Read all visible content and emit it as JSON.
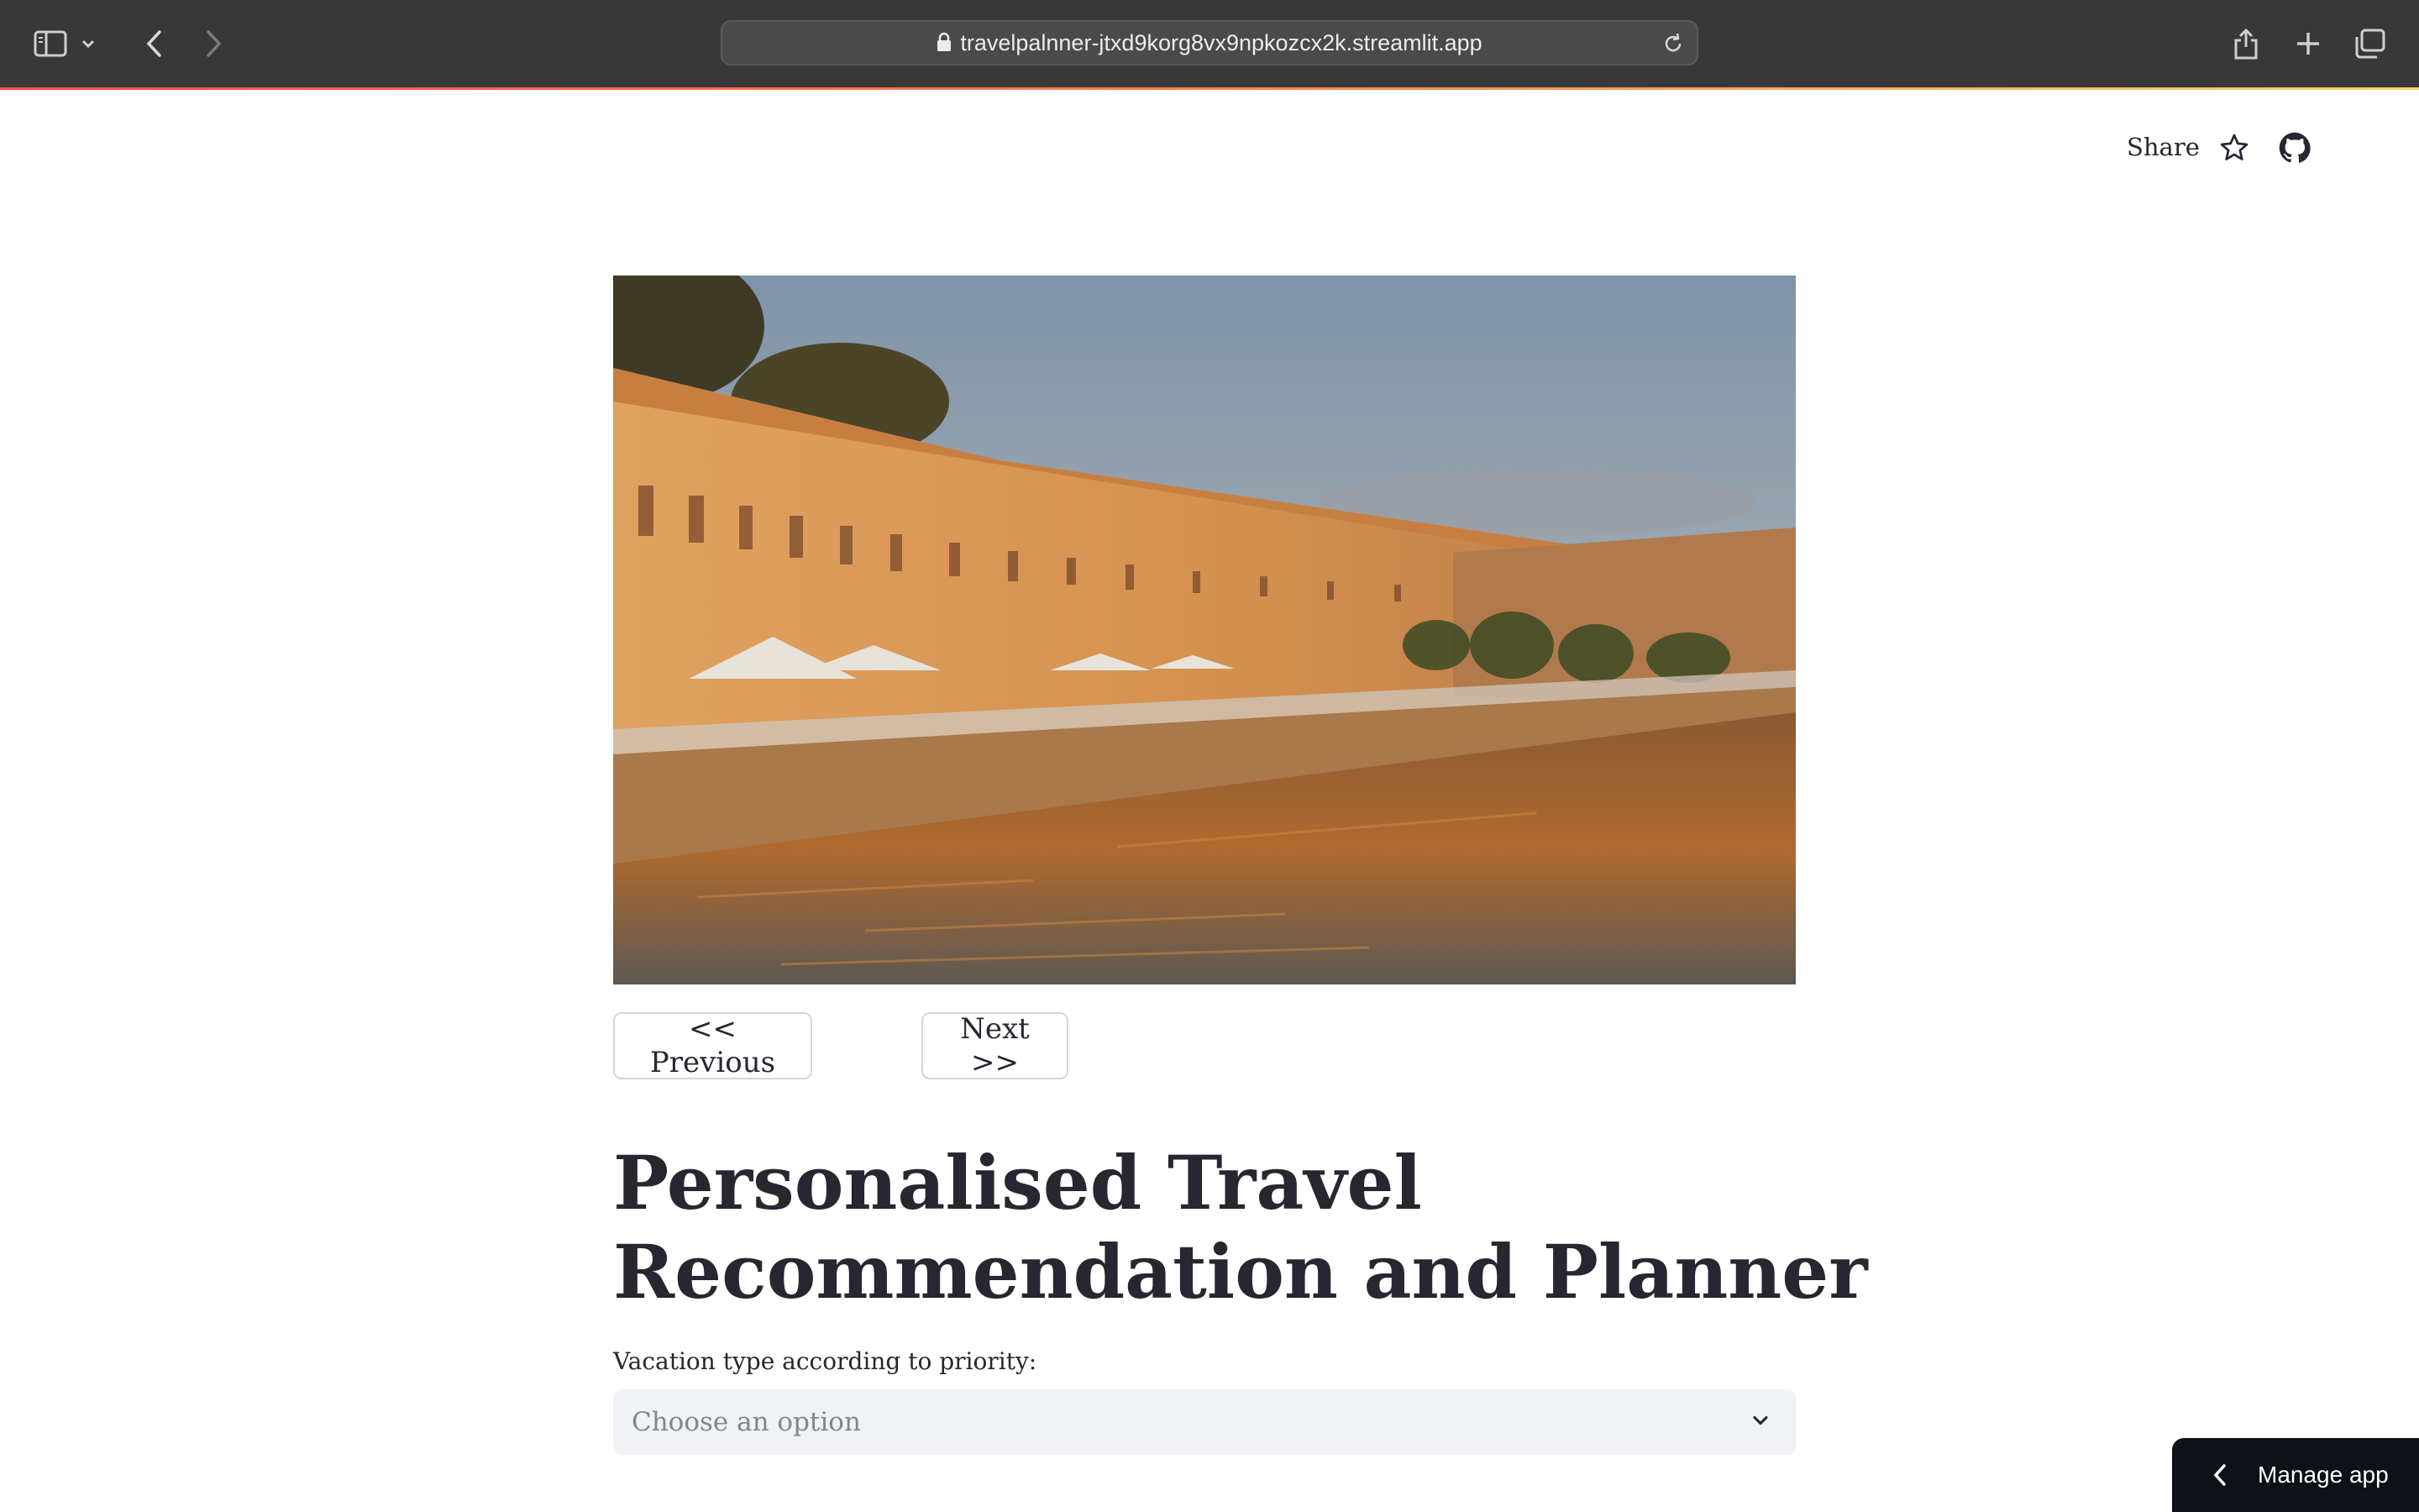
{
  "browser": {
    "url": "travelpalnner-jtxd9korg8vx9npkozcx2k.streamlit.app",
    "icons": [
      "sidebar-icon",
      "chevron-down-icon",
      "back-icon",
      "forward-icon",
      "lock-icon",
      "reload-icon",
      "share-icon",
      "new-tab-icon",
      "tabs-overview-icon"
    ]
  },
  "header": {
    "share_label": "Share",
    "icons": [
      "star-icon",
      "github-icon"
    ]
  },
  "carousel": {
    "prev_label": "<< Previous",
    "next_label": "Next >>"
  },
  "main": {
    "title": "Personalised Travel Recommendation and Planner",
    "vacation_select": {
      "label": "Vacation type according to priority:",
      "placeholder": "Choose an option"
    }
  },
  "manage_app": {
    "label": "Manage app"
  },
  "colors": {
    "toolbar_bg": "#383838",
    "text": "#262730",
    "select_bg": "#f0f2f6",
    "manage_bg": "#0e1117",
    "accent": "#ff4b4b"
  }
}
